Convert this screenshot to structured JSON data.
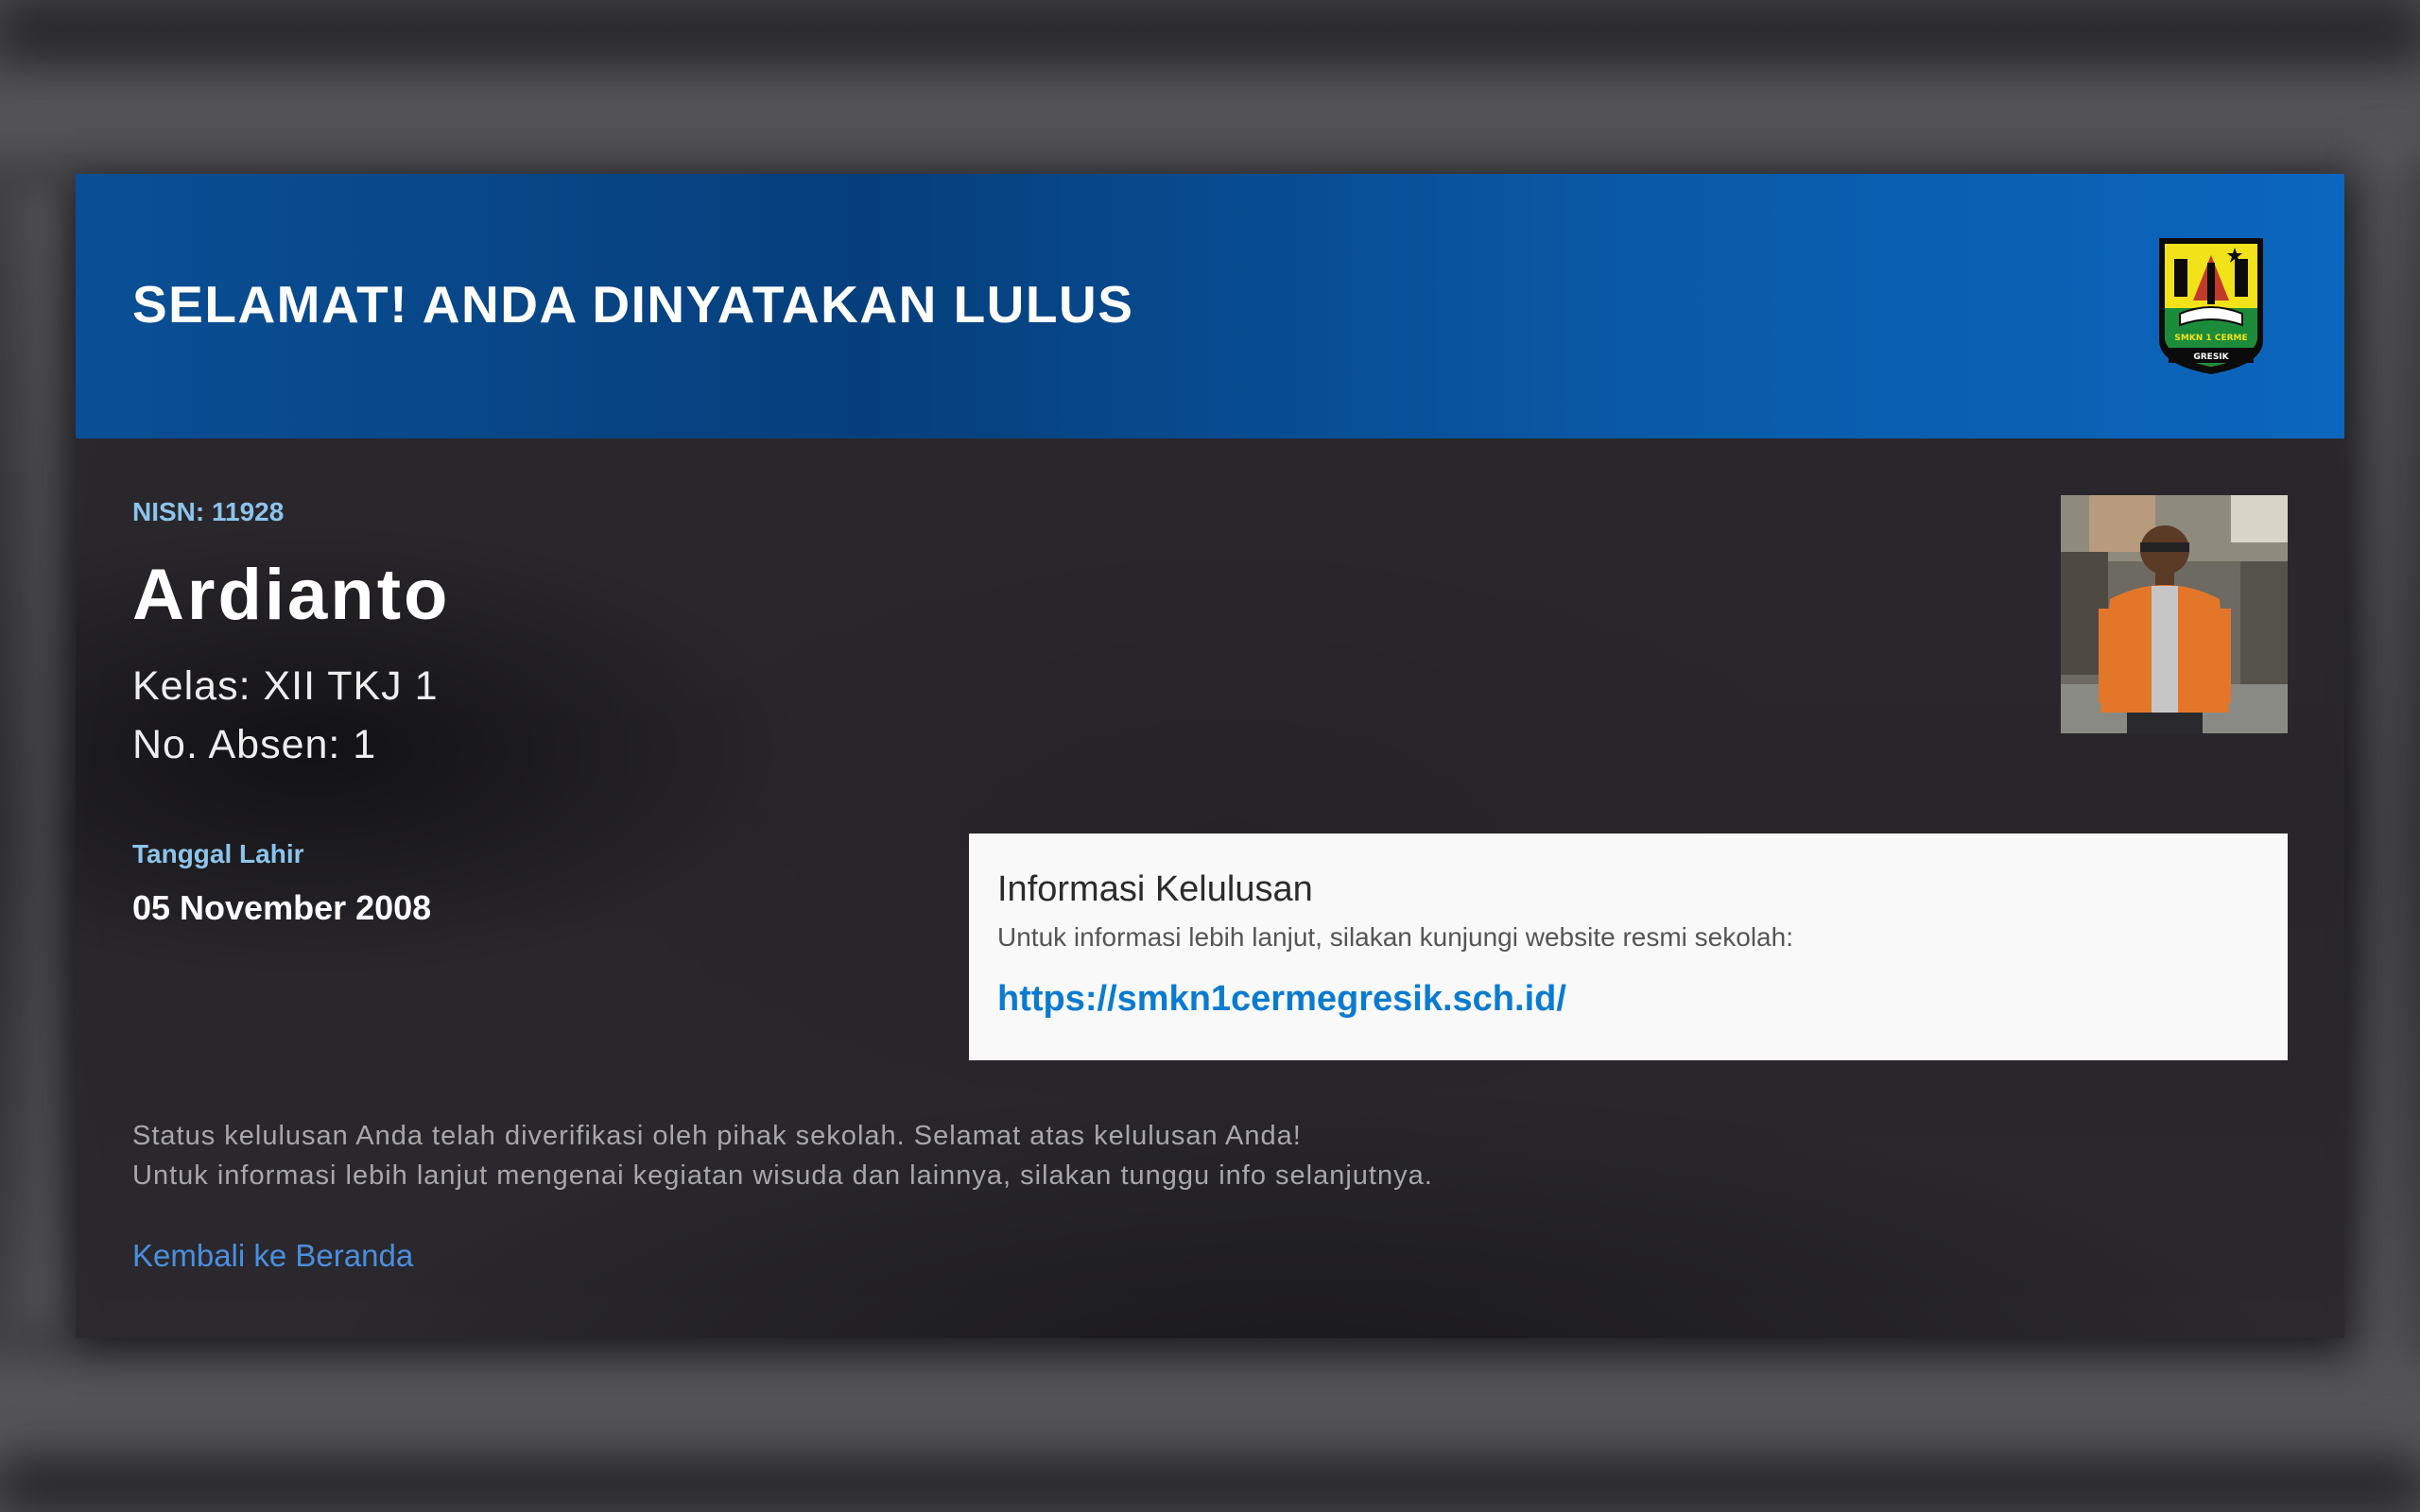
{
  "header": {
    "title": "SELAMAT! ANDA DINYATAKAN LULUS",
    "logo_icon": "school-crest-icon",
    "logo_text": "SMKN 1 CERME",
    "logo_banner": "GRESIK"
  },
  "student": {
    "nisn": "NISN: 11928",
    "name": "Ardianto",
    "kelas": "Kelas: XII TKJ 1",
    "absen": "No. Absen: 1",
    "dob_label": "Tanggal Lahir",
    "dob_value": "05 November 2008"
  },
  "info": {
    "title": "Informasi Kelulusan",
    "description": "Untuk informasi lebih lanjut, silakan kunjungi website resmi sekolah:",
    "link": "https://smkn1cermegresik.sch.id/"
  },
  "status": {
    "line1": "Status kelulusan Anda telah diverifikasi oleh pihak sekolah. Selamat atas kelulusan Anda!",
    "line2": "Untuk informasi lebih lanjut mengenai kegiatan wisuda dan lainnya, silakan tunggu info selanjutnya."
  },
  "nav": {
    "back_label": "Kembali ke Beranda"
  },
  "colors": {
    "header_blue": "#0a5aa8",
    "accent_light_blue": "#8cc4ec",
    "link_blue": "#0a7bd1",
    "back_link_blue": "#4a8fe0"
  }
}
